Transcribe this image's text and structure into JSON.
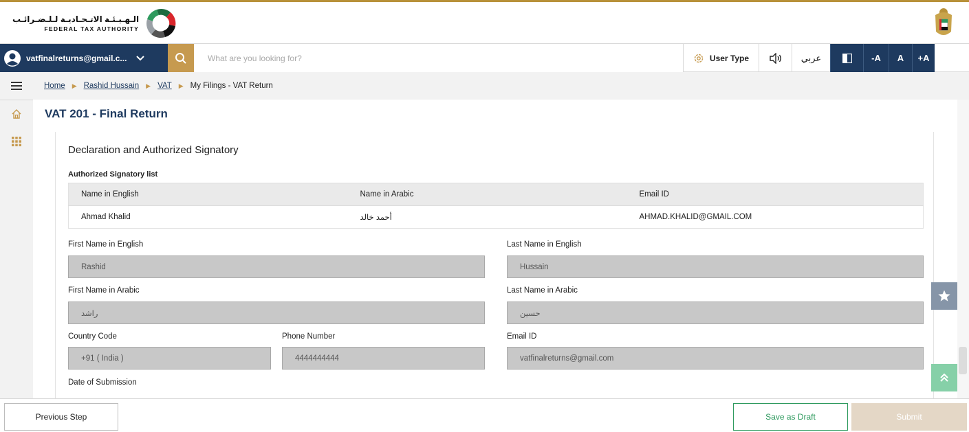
{
  "header": {
    "logo_arabic": "الـهـيـئـة الاتـحـاديـة لـلـضـرائـب",
    "logo_english": "FEDERAL TAX AUTHORITY"
  },
  "toolbar": {
    "user_email": "vatfinalreturns@gmail.c...",
    "search_placeholder": "What are you looking for?",
    "user_type_label": "User Type",
    "arabic_label": "عربي",
    "font_decrease": "-A",
    "font_normal": "A",
    "font_increase": "+A"
  },
  "breadcrumb": {
    "home": "Home",
    "user": "Rashid Hussain",
    "vat": "VAT",
    "current": "My Filings - VAT Return"
  },
  "page": {
    "title": "VAT 201 - Final Return"
  },
  "declaration": {
    "section_title": "Declaration and Authorized Signatory",
    "list_title": "Authorized Signatory list",
    "table": {
      "headers": [
        "Name in English",
        "Name in Arabic",
        "Email ID"
      ],
      "rows": [
        [
          "Ahmad Khalid",
          "أحمد خالد",
          "AHMAD.KHALID@GMAIL.COM"
        ]
      ]
    },
    "fields": {
      "first_name_en": {
        "label": "First Name in English",
        "value": "Rashid"
      },
      "last_name_en": {
        "label": "Last Name in English",
        "value": "Hussain"
      },
      "first_name_ar": {
        "label": "First Name in Arabic",
        "value": "راشد"
      },
      "last_name_ar": {
        "label": "Last Name in Arabic",
        "value": "حسين"
      },
      "country_code": {
        "label": "Country Code",
        "value": "+91 ( India )"
      },
      "phone": {
        "label": "Phone Number",
        "value": "4444444444"
      },
      "email": {
        "label": "Email ID",
        "value": "vatfinalreturns@gmail.com"
      },
      "date_submission": {
        "label": "Date of Submission"
      }
    }
  },
  "footer": {
    "previous_label": "Previous Step",
    "draft_label": "Save as Draft",
    "submit_label": "Submit"
  },
  "colors": {
    "navy": "#1e3a5f",
    "gold": "#c69a4f",
    "green": "#2e9a5e",
    "disabled_submit": "#e4d7c6"
  },
  "icons": [
    "fta-logo-icon",
    "uae-emblem-icon",
    "user-avatar-icon",
    "chevron-down-icon",
    "search-icon",
    "gear-icon",
    "speaker-icon",
    "contrast-icon",
    "hamburger-icon",
    "home-icon",
    "apps-grid-icon",
    "star-icon",
    "double-chevron-up-icon"
  ]
}
